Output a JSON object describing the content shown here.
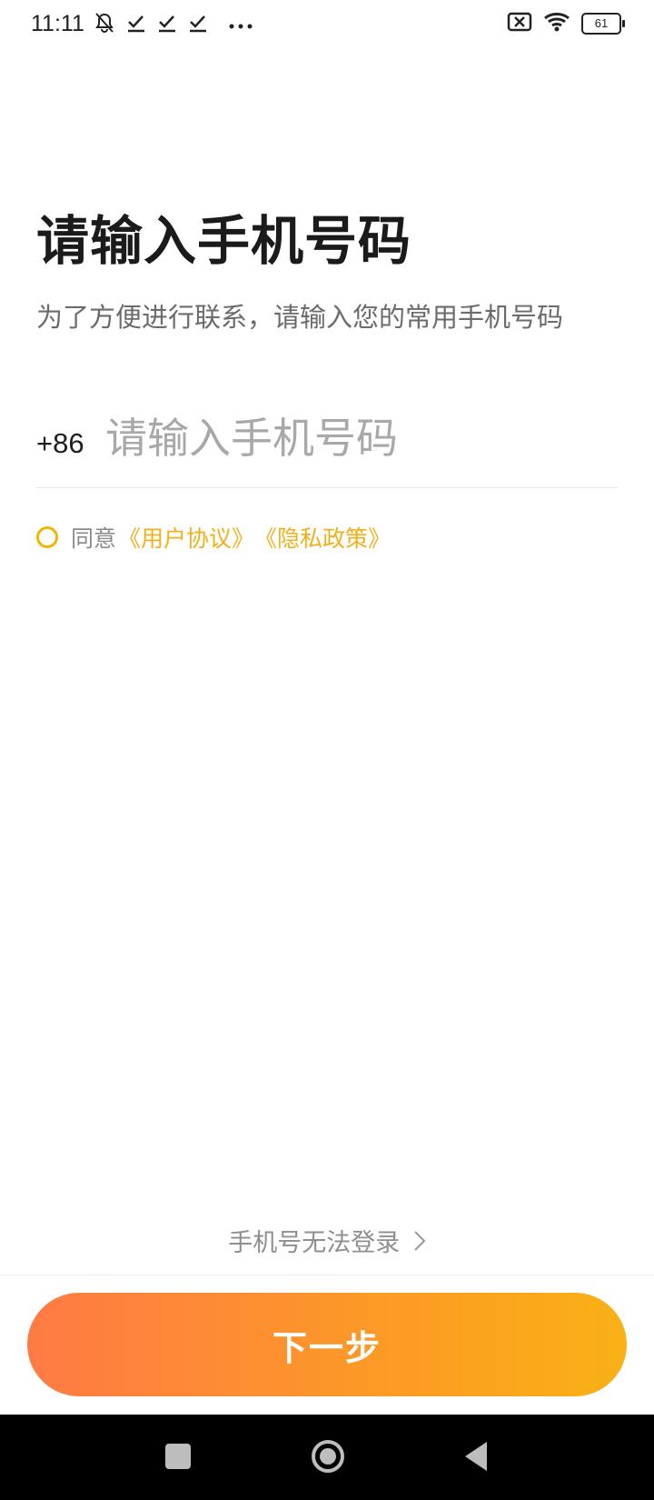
{
  "status_bar": {
    "time": "11:11",
    "left_icons": [
      "mute-icon",
      "check-icon",
      "check-icon",
      "check-icon",
      "more-dots-icon"
    ],
    "right_icons": [
      "sim-off-icon",
      "wifi-icon",
      "battery-icon"
    ],
    "battery_level": "61"
  },
  "page": {
    "title": "请输入手机号码",
    "subtitle": "为了方便进行联系，请输入您的常用手机号码"
  },
  "phone_field": {
    "country_code": "+86",
    "placeholder": "请输入手机号码",
    "value": ""
  },
  "agreement": {
    "checked": false,
    "prefix": "同意",
    "user_agreement": "《用户协议》",
    "privacy_policy": "《隐私政策》"
  },
  "help": {
    "label": "手机号无法登录"
  },
  "primary_action": {
    "label": "下一步",
    "gradient_start": "#ff7a45",
    "gradient_end": "#f9b116"
  },
  "colors": {
    "accent": "#f0b01a",
    "text_primary": "#1b1b1b",
    "text_secondary": "#6b6b6b",
    "placeholder": "#a8a8a8"
  }
}
